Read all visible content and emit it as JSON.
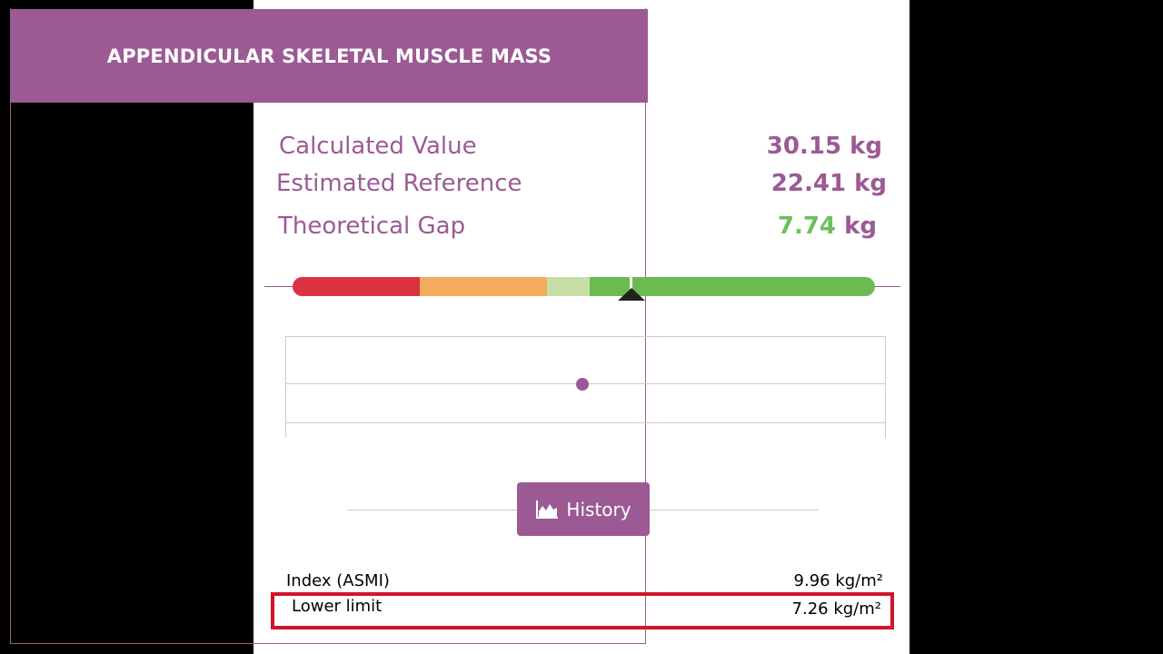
{
  "header": {
    "title": "APPENDICULAR SKELETAL MUSCLE MASS"
  },
  "metrics": {
    "calculated": {
      "label": "Calculated Value",
      "value": "30.15 kg"
    },
    "estimated": {
      "label": "Estimated Reference",
      "value": "22.41 kg"
    },
    "gap": {
      "label": "Theoretical Gap",
      "number": "7.74",
      "unit": "kg"
    }
  },
  "scale": {
    "segments": [
      "red",
      "orange",
      "light-green",
      "green"
    ],
    "colors": {
      "red": "#db3241",
      "orange": "#f2ac5c",
      "light-green": "#c7dfa6",
      "green": "#6cbb52"
    },
    "marker_fraction": 0.58
  },
  "history": {
    "button_label": "History",
    "icon": "area-chart-icon"
  },
  "details": {
    "index": {
      "label": "Index (ASMI)",
      "value": "9.96 kg/m²"
    },
    "lower_limit": {
      "label": "Lower limit",
      "value": "7.26 kg/m²"
    }
  },
  "colors": {
    "brand": "#9b5a94",
    "positive": "#6cc15a",
    "highlight": "#d2142a"
  }
}
